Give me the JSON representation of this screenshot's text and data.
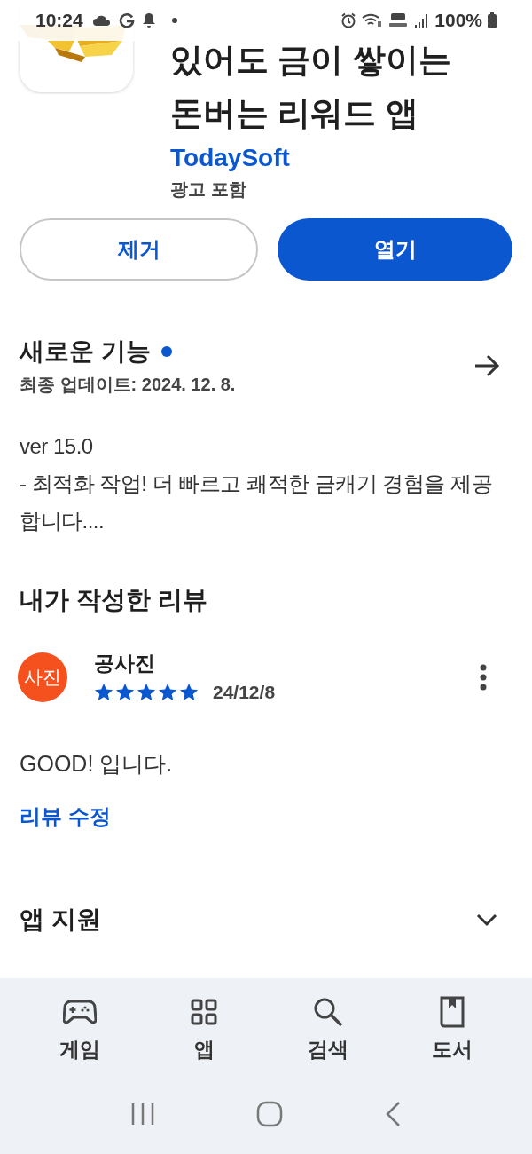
{
  "status_bar": {
    "time": "10:24",
    "battery": "100%"
  },
  "app": {
    "title_lines": [
      "있어도 금이 쌓이는",
      "돈버는 리워드 앱"
    ],
    "developer": "TodaySoft",
    "ads_note": "광고 포함"
  },
  "actions": [
    {
      "label": "제거",
      "kind": "outline"
    },
    {
      "label": "열기",
      "kind": "filled"
    }
  ],
  "whats_new": {
    "title": "새로운 기능",
    "new_indicator": true,
    "updated": "최종 업데이트: 2024. 12. 8.",
    "lines": [
      "ver 15.0",
      "- 최적화 작업! 더 빠르고 쾌적한 금캐기 경험을 제공합니다...."
    ]
  },
  "my_review": {
    "title": "내가 작성한 리뷰",
    "avatar_text": "사진",
    "author": "공사진",
    "stars": 5,
    "date": "24/12/8",
    "text": "GOOD! 입니다.",
    "edit_link": "리뷰 수정"
  },
  "app_support": {
    "title": "앱 지원",
    "expanded": false
  },
  "bottom_nav": [
    {
      "label": "게임",
      "kind": "games",
      "selected": false
    },
    {
      "label": "앱",
      "kind": "apps",
      "selected": false
    },
    {
      "label": "검색",
      "kind": "search",
      "selected": false
    },
    {
      "label": "도서",
      "kind": "books",
      "selected": false
    }
  ]
}
